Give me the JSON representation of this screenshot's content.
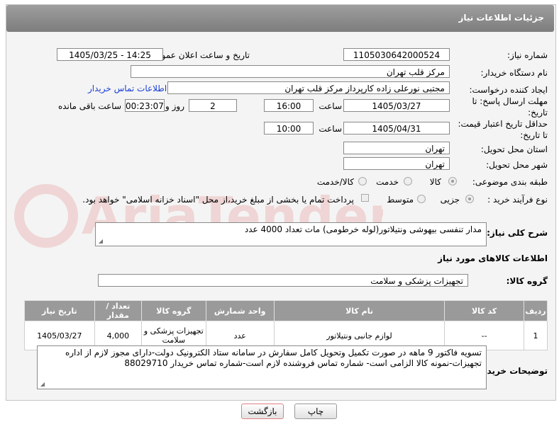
{
  "header": {
    "title": "جزئیات اطلاعات نیاز"
  },
  "form": {
    "need_number_label": "شماره نیاز:",
    "need_number": "1105030642000524",
    "announce_label": "تاریخ و ساعت اعلان عمومی:",
    "announce_value": "1405/03/25 - 14:25",
    "buyer_org_label": "نام دستگاه خریدار:",
    "buyer_org": "مرکز قلب تهران",
    "creator_label": "ایجاد کننده درخواست:",
    "creator": "مجتبی نورعلی زاده کارپرداز مرکز قلب تهران",
    "contact_link": "اطلاعات تماس خریدار",
    "reply_deadline_label_1": "مهلت ارسال پاسخ: تا",
    "reply_deadline_label_2": "تاریخ:",
    "reply_date": "1405/03/27",
    "time_label": "ساعت",
    "reply_time": "16:00",
    "days_value": "2",
    "days_label": "روز و",
    "remaining_time": "00:23:07",
    "remaining_label": "ساعت باقی مانده",
    "price_validity_label_1": "حداقل تاریخ اعتبار قیمت:",
    "price_validity_label_2": "تا تاریخ:",
    "price_date": "1405/04/31",
    "price_time": "10:00",
    "province_label": "استان محل تحویل:",
    "province": "تهران",
    "city_label": "شهر محل تحویل:",
    "city": "تهران",
    "category_label": "طبقه بندی موضوعی:",
    "category_options": [
      "کالا",
      "خدمت",
      "کالا/خدمت"
    ],
    "process_label": "نوع فرآیند خرید :",
    "process_options": [
      "جزیی",
      "متوسط"
    ],
    "payment_note": "پرداخت تمام یا بخشی از مبلغ خرید،از محل \"اسناد خزانه اسلامی\" خواهد بود.",
    "description_label": "شرح کلی نیاز:",
    "description": "مدار تنفسی بیهوشی ونتیلاتور(لوله خرطومی) مات تعداد 4000 عدد"
  },
  "goods": {
    "section_title": "اطلاعات کالاهای مورد نیاز",
    "group_label": "گروه کالا:",
    "group_value": "تجهیزات پزشکی و سلامت",
    "columns": [
      "ردیف",
      "کد کالا",
      "نام کالا",
      "واحد شمارش",
      "گروه کالا",
      "تعداد / مقدار",
      "تاریخ نیاز"
    ],
    "rows": [
      {
        "row": "1",
        "code": "--",
        "name": "لوازم جانبی ونتیلاتور",
        "unit": "عدد",
        "group": "تجهیزات پزشکی و سلامت",
        "qty": "4,000",
        "date": "1405/03/27"
      }
    ]
  },
  "buyer_notes_label": "توضیحات خریدار:",
  "buyer_notes": "تسویه فاکتور 9 ماهه در صورت تکمیل وتحویل کامل سفارش در سامانه  ستاد الکترونیک دولت-دارای مجوز لازم از اداره تجهیزات-نمونه کالا الزامی است- شماره تماس فروشنده لازم است-شماره تماس خریدار 88029710",
  "buttons": {
    "print": "چاپ",
    "back": "بازگشت"
  },
  "watermark_text": "AriaTender.neT",
  "colors": {
    "title_bar": "#8a8a8a",
    "link": "#1a3fd6",
    "back_button_border": "#e08080"
  }
}
